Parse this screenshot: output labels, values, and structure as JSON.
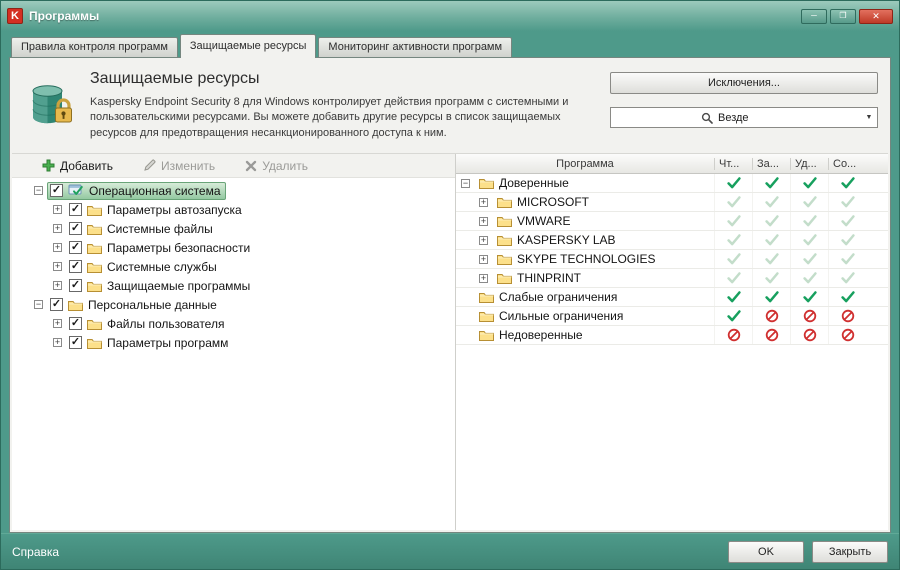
{
  "window": {
    "title": "Программы"
  },
  "icons": {
    "minimize": "─",
    "maximize": "❐",
    "close": "✕",
    "dropdown": "▼",
    "expand": "+",
    "collapse": "−",
    "checkbox_check": "✓",
    "logo_letter": "K"
  },
  "colors": {
    "accent_teal": "#4e9a8a",
    "selection_green": "#93c9a1",
    "allow_green": "#17a05e",
    "deny_red": "#d03030",
    "folder_yellow": "#fce08a"
  },
  "tabs": [
    {
      "label": "Правила контроля программ",
      "active": false
    },
    {
      "label": "Защищаемые ресурсы",
      "active": true
    },
    {
      "label": "Мониторинг активности программ",
      "active": false
    }
  ],
  "header": {
    "title": "Защищаемые ресурсы",
    "description": "Kaspersky Endpoint Security 8 для Windows контролирует действия программ с системными и пользовательскими ресурсами. Вы можете добавить другие ресурсы в список защищаемых ресурсов для предотвращения несанкционированного доступа к ним.",
    "exclusions_button": "Исключения...",
    "search_value": "",
    "search_scope": "Везде"
  },
  "toolbar": {
    "add": "Добавить",
    "edit": "Изменить",
    "delete": "Удалить"
  },
  "tree": [
    {
      "label": "Операционная система",
      "level": 0,
      "expander": "minus",
      "checked": true,
      "selected": true,
      "icon": "system"
    },
    {
      "label": "Параметры автозапуска",
      "level": 1,
      "expander": "plus",
      "checked": true,
      "selected": false,
      "icon": "folder"
    },
    {
      "label": "Системные файлы",
      "level": 1,
      "expander": "plus",
      "checked": true,
      "selected": false,
      "icon": "folder"
    },
    {
      "label": "Параметры безопасности",
      "level": 1,
      "expander": "plus",
      "checked": true,
      "selected": false,
      "icon": "folder"
    },
    {
      "label": "Системные службы",
      "level": 1,
      "expander": "plus",
      "checked": true,
      "selected": false,
      "icon": "folder"
    },
    {
      "label": "Защищаемые программы",
      "level": 1,
      "expander": "plus",
      "checked": true,
      "selected": false,
      "icon": "folder"
    },
    {
      "label": "Персональные данные",
      "level": 0,
      "expander": "minus",
      "checked": true,
      "selected": false,
      "icon": "folder"
    },
    {
      "label": "Файлы пользователя",
      "level": 1,
      "expander": "plus",
      "checked": true,
      "selected": false,
      "icon": "folder"
    },
    {
      "label": "Параметры программ",
      "level": 1,
      "expander": "plus",
      "checked": true,
      "selected": false,
      "icon": "folder"
    }
  ],
  "table": {
    "columns": [
      "Программа",
      "Чт...",
      "За...",
      "Уд...",
      "Со..."
    ],
    "rows": [
      {
        "label": "Доверенные",
        "level": 0,
        "expander": "minus",
        "statuses": [
          "check",
          "check",
          "check",
          "check"
        ]
      },
      {
        "label": "MICROSOFT",
        "level": 1,
        "expander": "plus",
        "statuses": [
          "faded",
          "faded",
          "faded",
          "faded"
        ]
      },
      {
        "label": "VMWARE",
        "level": 1,
        "expander": "plus",
        "statuses": [
          "faded",
          "faded",
          "faded",
          "faded"
        ]
      },
      {
        "label": "KASPERSKY LAB",
        "level": 1,
        "expander": "plus",
        "statuses": [
          "faded",
          "faded",
          "faded",
          "faded"
        ]
      },
      {
        "label": "SKYPE TECHNOLOGIES",
        "level": 1,
        "expander": "plus",
        "statuses": [
          "faded",
          "faded",
          "faded",
          "faded"
        ]
      },
      {
        "label": "THINPRINT",
        "level": 1,
        "expander": "plus",
        "statuses": [
          "faded",
          "faded",
          "faded",
          "faded"
        ]
      },
      {
        "label": "Слабые ограничения",
        "level": 0,
        "expander": "none",
        "statuses": [
          "check",
          "check",
          "check",
          "check"
        ]
      },
      {
        "label": "Сильные ограничения",
        "level": 0,
        "expander": "none",
        "statuses": [
          "check",
          "deny",
          "deny",
          "deny"
        ]
      },
      {
        "label": "Недоверенные",
        "level": 0,
        "expander": "none",
        "statuses": [
          "deny",
          "deny",
          "deny",
          "deny"
        ]
      }
    ]
  },
  "footer": {
    "help": "Справка",
    "ok": "OK",
    "close": "Закрыть"
  }
}
